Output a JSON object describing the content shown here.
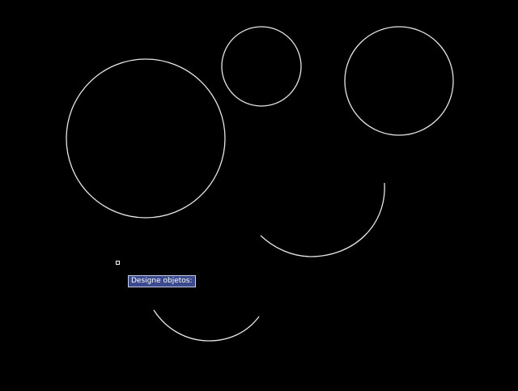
{
  "canvas": {
    "background": "#000000",
    "entity_color": "#e6e6e6"
  },
  "cursor": {
    "type": "pickbox-icon"
  },
  "tooltip": {
    "prompt": "Designe objetos:",
    "background": "#3b4a8c",
    "border": "#c8cce8"
  }
}
